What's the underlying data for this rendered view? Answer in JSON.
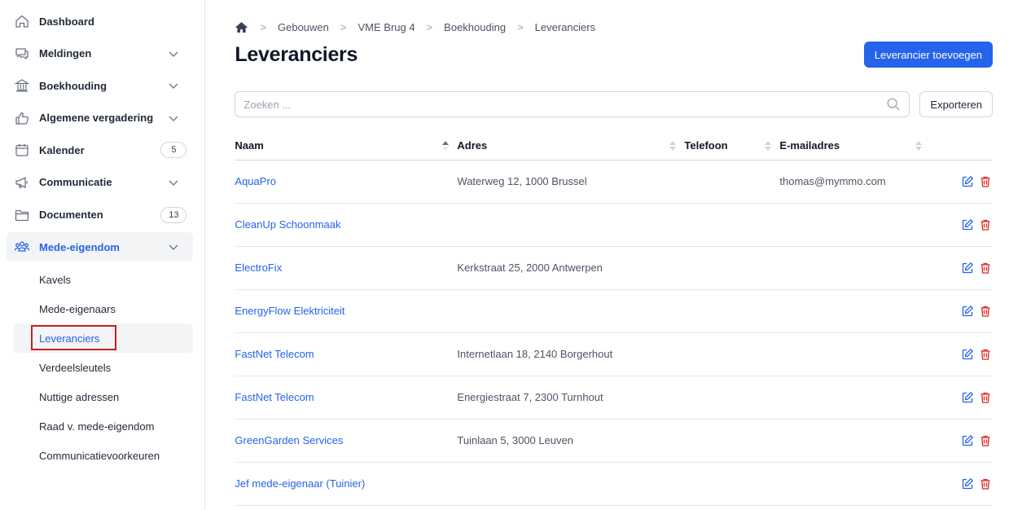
{
  "sidebar": {
    "items": [
      {
        "label": "Dashboard",
        "icon": "home-icon",
        "chevron": false,
        "badge": null
      },
      {
        "label": "Meldingen",
        "icon": "chat-icon",
        "chevron": true,
        "badge": null
      },
      {
        "label": "Boekhouding",
        "icon": "bank-icon",
        "chevron": true,
        "badge": null
      },
      {
        "label": "Algemene vergadering",
        "icon": "thumbs-up-icon",
        "chevron": true,
        "badge": null
      },
      {
        "label": "Kalender",
        "icon": "calendar-icon",
        "chevron": false,
        "badge": "5"
      },
      {
        "label": "Communicatie",
        "icon": "megaphone-icon",
        "chevron": true,
        "badge": null
      },
      {
        "label": "Documenten",
        "icon": "folder-icon",
        "chevron": false,
        "badge": "13"
      },
      {
        "label": "Mede-eigendom",
        "icon": "users-icon",
        "chevron": true,
        "badge": null,
        "active": true
      }
    ],
    "sub_items": [
      {
        "label": "Kavels"
      },
      {
        "label": "Mede-eigenaars"
      },
      {
        "label": "Leveranciers",
        "active": true
      },
      {
        "label": "Verdeelsleutels"
      },
      {
        "label": "Nuttige adressen"
      },
      {
        "label": "Raad v. mede-eigendom"
      },
      {
        "label": "Communicatievoorkeuren"
      }
    ]
  },
  "breadcrumb": [
    "Gebouwen",
    "VME Brug 4",
    "Boekhouding",
    "Leveranciers"
  ],
  "page_title": "Leveranciers",
  "add_button": "Leverancier toevoegen",
  "search": {
    "placeholder": "Zoeken ...",
    "value": ""
  },
  "export_button": "Exporteren",
  "table": {
    "columns": [
      "Naam",
      "Adres",
      "Telefoon",
      "E-mailadres"
    ],
    "rows": [
      {
        "name": "AquaPro",
        "address": "Waterweg 12, 1000 Brussel",
        "phone": "",
        "email": "thomas@mymmo.com"
      },
      {
        "name": "CleanUp Schoonmaak",
        "address": "",
        "phone": "",
        "email": ""
      },
      {
        "name": "ElectroFix",
        "address": "Kerkstraat 25, 2000 Antwerpen",
        "phone": "",
        "email": ""
      },
      {
        "name": "EnergyFlow Elektriciteit",
        "address": "",
        "phone": "",
        "email": ""
      },
      {
        "name": "FastNet Telecom",
        "address": "Internetlaan 18, 2140 Borgerhout",
        "phone": "",
        "email": ""
      },
      {
        "name": "FastNet Telecom",
        "address": "Energiestraat 7, 2300 Turnhout",
        "phone": "",
        "email": ""
      },
      {
        "name": "GreenGarden Services",
        "address": "Tuinlaan 5, 3000 Leuven",
        "phone": "",
        "email": ""
      },
      {
        "name": "Jef mede-eigenaar (Tuinier)",
        "address": "",
        "phone": "",
        "email": ""
      }
    ]
  },
  "colors": {
    "accent": "#2563eb",
    "danger": "#dc2626",
    "highlight": "#c81e1e"
  }
}
